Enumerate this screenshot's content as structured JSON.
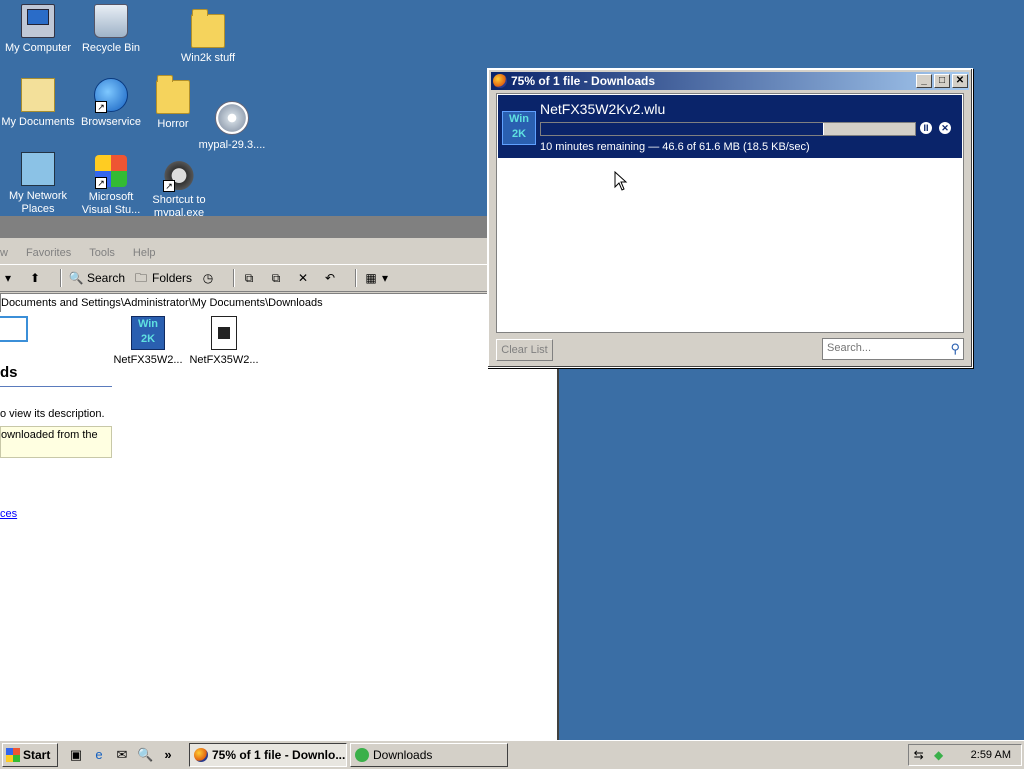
{
  "desktop": {
    "icons": [
      {
        "label": "My Computer"
      },
      {
        "label": "Recycle Bin"
      },
      {
        "label": "Win2k stuff"
      },
      {
        "label": "My Documents"
      },
      {
        "label": "Browservice"
      },
      {
        "label": "Horror"
      },
      {
        "label": "mypal-29.3...."
      },
      {
        "label": "My Network Places"
      },
      {
        "label": "Microsoft Visual Stu..."
      },
      {
        "label": "Shortcut to mypal.exe"
      }
    ]
  },
  "explorer": {
    "menu": [
      "w",
      "Favorites",
      "Tools",
      "Help"
    ],
    "toolbar": {
      "search_label": "Search",
      "folders_label": "Folders"
    },
    "address": "Documents and Settings\\Administrator\\My Documents\\Downloads",
    "files": [
      {
        "label": "NetFX35W2..."
      },
      {
        "label": "NetFX35W2..."
      }
    ],
    "webview": {
      "title": "ds",
      "desc": "o view its description.",
      "box_text": "ownloaded from the",
      "link": "ces"
    }
  },
  "downloads": {
    "title": "75% of 1 file - Downloads",
    "item": {
      "name": "NetFX35W2Kv2.wlu",
      "progress": 0.755,
      "status": "10 minutes remaining — 46.6 of 61.6 MB (18.5 KB/sec)",
      "icon_text": "Win 2K"
    },
    "clear_list": "Clear List",
    "search_placeholder": "Search..."
  },
  "taskbar": {
    "start_label": "Start",
    "tasks": [
      {
        "label": "75% of 1 file - Downlo..."
      },
      {
        "label": "Downloads"
      }
    ],
    "clock": "2:59 AM"
  }
}
